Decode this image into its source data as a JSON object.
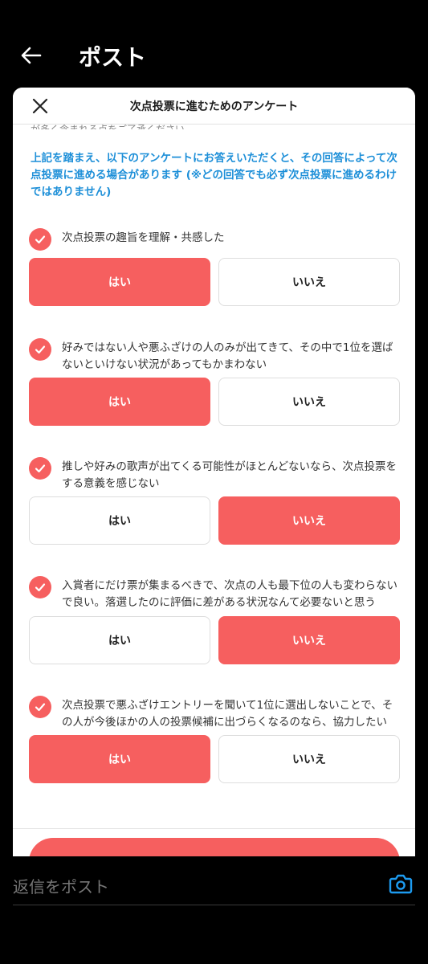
{
  "header": {
    "title": "ポスト"
  },
  "modal": {
    "title": "次点投票に進むためのアンケート",
    "cut_text": "が多く含まれる点をご了承ください",
    "notice": "上記を踏まえ、以下のアンケートにお答えいただくと、その回答によって次点投票に進める場合があります (※どの回答でも必ず次点投票に進めるわけではありません)"
  },
  "questions": [
    {
      "text": "次点投票の趣旨を理解・共感した",
      "yes": "はい",
      "no": "いいえ",
      "selected": "yes"
    },
    {
      "text": "好みではない人や悪ふざけの人のみが出てきて、その中で1位を選ばないといけない状況があってもかまわない",
      "yes": "はい",
      "no": "いいえ",
      "selected": "yes"
    },
    {
      "text": "推しや好みの歌声が出てくる可能性がほとんどないなら、次点投票をする意義を感じない",
      "yes": "はい",
      "no": "いいえ",
      "selected": "no"
    },
    {
      "text": "入賞者にだけ票が集まるべきで、次点の人も最下位の人も変わらないで良い。落選したのに評価に差がある状況なんて必要ないと思う",
      "yes": "はい",
      "no": "いいえ",
      "selected": "no"
    },
    {
      "text": "次点投票で悪ふざけエントリーを聞いて1位に選出しないことで、その人が今後ほかの人の投票候補に出づらくなるのなら、協力したい",
      "yes": "はい",
      "no": "いいえ",
      "selected": "yes"
    }
  ],
  "reply": {
    "placeholder": "返信をポスト"
  },
  "colors": {
    "accent": "#f65f5f",
    "notice": "#1d8fd8",
    "camera": "#1d9bf0"
  }
}
